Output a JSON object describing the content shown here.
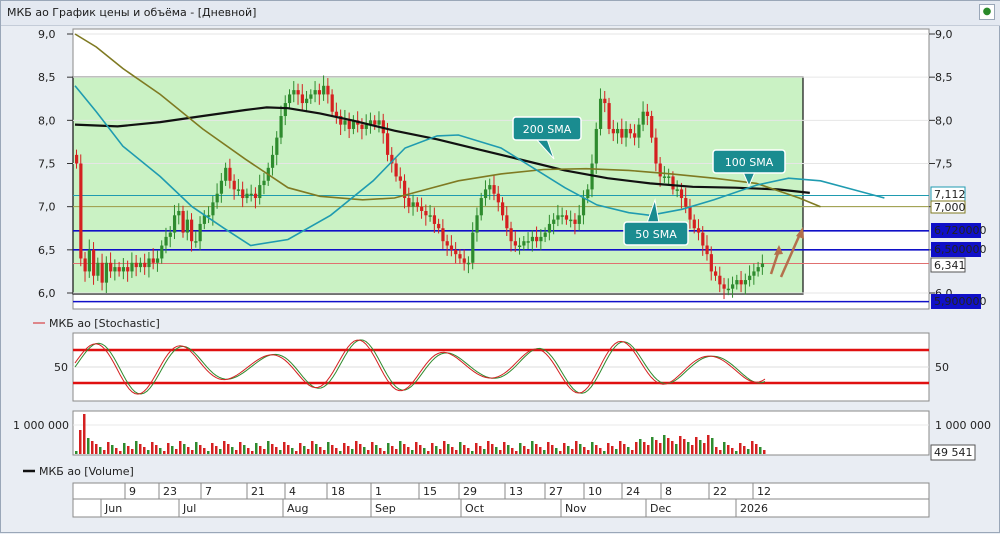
{
  "window": {
    "title": "МКБ ао График цены и объёма - [Дневной]",
    "pin_icon": "pin-icon"
  },
  "colors": {
    "zone": "#caf2c4",
    "candle_up": "#2e8b2e",
    "candle_down": "#d42020",
    "sma200": "#111111",
    "sma100": "#7f7a22",
    "sma50": "#1f9bb0",
    "blue_level": "#1010c8",
    "red_level": "#e01010",
    "arrow": "#b4704c",
    "callout": "#1a8c90"
  },
  "price_axis": {
    "ticks": [
      "9,0",
      "8,5",
      "8,0",
      "7,5",
      "7,0",
      "6,5",
      "6,0"
    ]
  },
  "price_labels": {
    "sma50": "7,112",
    "sma100": "7,000",
    "last_close": "6,341"
  },
  "levels": {
    "l1": "6,720000",
    "l2": "6,500000",
    "l3": "5,900000"
  },
  "callouts": {
    "sma200": "200 SMA",
    "sma100": "100 SMA",
    "sma50": "50 SMA"
  },
  "stoch_panel": {
    "legend": "МКБ ао [Stochastic]",
    "tick": "50"
  },
  "volume_panel": {
    "tick": "1 000 000",
    "last_value": "49 541",
    "legend": "МКБ ао [Volume]"
  },
  "date_axis": {
    "days": [
      "9",
      "23",
      "7",
      "21",
      "4",
      "18",
      "1",
      "15",
      "29",
      "13",
      "27",
      "10",
      "24",
      "8",
      "22",
      "12"
    ],
    "months": [
      "Jun",
      "Jul",
      "Aug",
      "Sep",
      "Oct",
      "Nov",
      "Dec",
      "2026"
    ]
  },
  "chart_data": {
    "type": "candlestick",
    "title": "МКБ ао График цены и объёма - [Дневной]",
    "period": "daily",
    "price_range": [
      6.0,
      9.0
    ],
    "trading_range": {
      "top": 8.5,
      "bottom": 6.0
    },
    "levels": [
      6.72,
      6.5,
      5.9
    ],
    "last_close": 6.341,
    "moving_averages": [
      {
        "name": "200 SMA",
        "last": null,
        "points": [
          [
            0,
            7.95
          ],
          [
            40,
            7.93
          ],
          [
            80,
            7.98
          ],
          [
            120,
            8.05
          ],
          [
            160,
            8.12
          ],
          [
            180,
            8.15
          ],
          [
            200,
            8.14
          ],
          [
            230,
            8.08
          ],
          [
            260,
            8.0
          ],
          [
            300,
            7.88
          ],
          [
            340,
            7.78
          ],
          [
            380,
            7.66
          ],
          [
            420,
            7.54
          ],
          [
            460,
            7.42
          ],
          [
            500,
            7.33
          ],
          [
            540,
            7.27
          ],
          [
            580,
            7.23
          ],
          [
            620,
            7.22
          ],
          [
            660,
            7.2
          ],
          [
            690,
            7.16
          ]
        ]
      },
      {
        "name": "100 SMA",
        "last": 7.0,
        "points": [
          [
            0,
            9.0
          ],
          [
            20,
            8.85
          ],
          [
            45,
            8.6
          ],
          [
            80,
            8.3
          ],
          [
            120,
            7.9
          ],
          [
            160,
            7.55
          ],
          [
            200,
            7.22
          ],
          [
            230,
            7.12
          ],
          [
            270,
            7.08
          ],
          [
            300,
            7.1
          ],
          [
            330,
            7.2
          ],
          [
            360,
            7.3
          ],
          [
            400,
            7.38
          ],
          [
            440,
            7.43
          ],
          [
            480,
            7.44
          ],
          [
            520,
            7.42
          ],
          [
            560,
            7.38
          ],
          [
            600,
            7.33
          ],
          [
            640,
            7.27
          ],
          [
            680,
            7.1
          ],
          [
            700,
            7.0
          ]
        ]
      },
      {
        "name": "50 SMA",
        "last": 7.112,
        "points": [
          [
            0,
            8.4
          ],
          [
            20,
            8.1
          ],
          [
            45,
            7.7
          ],
          [
            80,
            7.35
          ],
          [
            110,
            7.0
          ],
          [
            140,
            6.75
          ],
          [
            165,
            6.55
          ],
          [
            200,
            6.62
          ],
          [
            240,
            6.9
          ],
          [
            280,
            7.3
          ],
          [
            310,
            7.68
          ],
          [
            340,
            7.82
          ],
          [
            360,
            7.83
          ],
          [
            400,
            7.68
          ],
          [
            430,
            7.45
          ],
          [
            460,
            7.22
          ],
          [
            490,
            7.02
          ],
          [
            520,
            6.93
          ],
          [
            540,
            6.9
          ],
          [
            570,
            6.97
          ],
          [
            600,
            7.08
          ],
          [
            640,
            7.25
          ],
          [
            670,
            7.33
          ],
          [
            700,
            7.3
          ],
          [
            730,
            7.2
          ],
          [
            760,
            7.1
          ]
        ]
      }
    ],
    "volume_tick": 1000000,
    "volume_last": 49541,
    "stochastic_levels": [
      80,
      20
    ]
  }
}
